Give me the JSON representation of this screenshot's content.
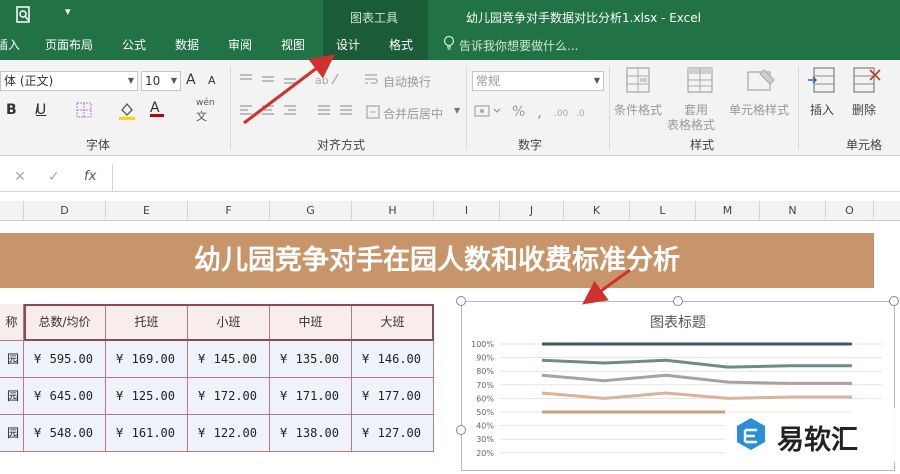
{
  "titlebar": {
    "qa_icon": "print-preview-icon",
    "qa_dropdown": "▾",
    "context_group": "图表工具",
    "window_title": "幼儿园竞争对手数据对比分析1.xlsx - Excel",
    "tabs": [
      "插入",
      "页面布局",
      "公式",
      "数据",
      "审阅",
      "视图",
      "设计",
      "格式"
    ],
    "tellme": "告诉我你想要做什么..."
  },
  "ribbon": {
    "font_name": "体 (正文)",
    "font_size": "10",
    "group_font": "字体",
    "group_align": "对齐方式",
    "group_number": "数字",
    "group_style": "样式",
    "group_cells": "单元格",
    "wrap_text": "自动换行",
    "merge_center": "合并后居中",
    "number_format": "常规",
    "percent": "%",
    "comma": ",",
    "cond_format": "条件格式",
    "table_format_1": "套用",
    "table_format_2": "表格格式",
    "cell_style": "单元格样式",
    "insert": "插入",
    "delete": "删除",
    "bold": "B",
    "italic": "I",
    "underline": "U",
    "grow_font": "A",
    "shrink_font": "A",
    "wen": "wén",
    "wen2": "文"
  },
  "formula_bar": {
    "cancel": "✕",
    "enter": "✓",
    "fx": "fx",
    "value": ""
  },
  "columns": [
    "D",
    "E",
    "F",
    "G",
    "H",
    "I",
    "J",
    "K",
    "L",
    "M",
    "N",
    "O"
  ],
  "banner": "幼儿园竞争对手在园人数和收费标准分析",
  "table": {
    "headers": [
      "称",
      "总数/均价",
      "托班",
      "小班",
      "中班",
      "大班"
    ],
    "rows": [
      {
        "name": "园",
        "values": [
          "595.00",
          "169.00",
          "145.00",
          "135.00",
          "146.00"
        ]
      },
      {
        "name": "园",
        "values": [
          "645.00",
          "125.00",
          "172.00",
          "171.00",
          "177.00"
        ]
      },
      {
        "name": "园",
        "values": [
          "548.00",
          "161.00",
          "122.00",
          "138.00",
          "127.00"
        ]
      }
    ],
    "currency": "¥"
  },
  "chart_data": {
    "type": "line",
    "title": "图表标题",
    "yticks": [
      "100%",
      "90%",
      "80%",
      "70%",
      "60%",
      "50%",
      "40%",
      "30%",
      "20%"
    ],
    "ylim": [
      0.2,
      1.0
    ],
    "series": [
      {
        "color": "#3d5a63",
        "values": [
          1.0,
          1.0,
          1.0,
          1.0,
          1.0,
          1.0
        ]
      },
      {
        "color": "#6f8a8a",
        "values": [
          0.88,
          0.86,
          0.88,
          0.83,
          0.84,
          0.84
        ]
      },
      {
        "color": "#a8a3a0",
        "values": [
          0.77,
          0.73,
          0.77,
          0.72,
          0.71,
          0.71
        ]
      },
      {
        "color": "#d9b39a",
        "values": [
          0.64,
          0.6,
          0.64,
          0.6,
          0.61,
          0.61
        ]
      },
      {
        "color": "#c8a27c",
        "values": [
          0.5,
          0.5,
          0.5,
          0.5,
          0.5,
          0.5
        ]
      }
    ]
  },
  "watermark": {
    "text": "易软汇"
  },
  "colors": {
    "excel_green": "#217346",
    "banner": "#c8956b",
    "arrow": "#d0312d"
  }
}
